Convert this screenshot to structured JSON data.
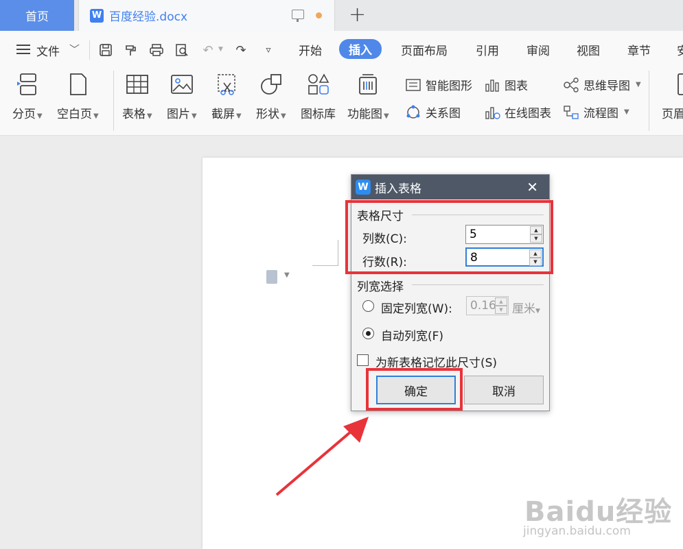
{
  "tabs": {
    "home": "首页",
    "doc_icon": "W",
    "doc_name": "百度经验.docx",
    "add": "+"
  },
  "menu": {
    "file": "文件",
    "ribbon_tabs": [
      "开始",
      "插入",
      "页面布局",
      "引用",
      "审阅",
      "视图",
      "章节",
      "安"
    ]
  },
  "ribbon_tools": {
    "big": [
      "分页",
      "空白页",
      "表格",
      "图片",
      "截屏",
      "形状",
      "图标库",
      "功能图",
      "页眉"
    ],
    "small": {
      "smartart": "智能图形",
      "relation": "关系图",
      "chart": "图表",
      "online_chart": "在线图表",
      "mindmap": "思维导图",
      "flowchart": "流程图"
    }
  },
  "dialog": {
    "title": "插入表格",
    "icon": "W",
    "close": "✕",
    "group_size": "表格尺寸",
    "cols_label": "列数(C):",
    "cols_value": "5",
    "rows_label": "行数(R):",
    "rows_value": "8",
    "group_width": "列宽选择",
    "fixed_width_label": "固定列宽(W):",
    "fixed_width_value": "0.16",
    "unit": "厘米",
    "auto_width_label": "自动列宽(F)",
    "remember_label": "为新表格记忆此尺寸(S)",
    "ok": "确定",
    "cancel": "取消"
  },
  "watermark": {
    "main": "Baidu经验",
    "sub": "jingyan.baidu.com"
  },
  "colors": {
    "accent": "#4f88e8",
    "highlight": "#e8333a",
    "dialog_title_bg": "#4e5866"
  }
}
